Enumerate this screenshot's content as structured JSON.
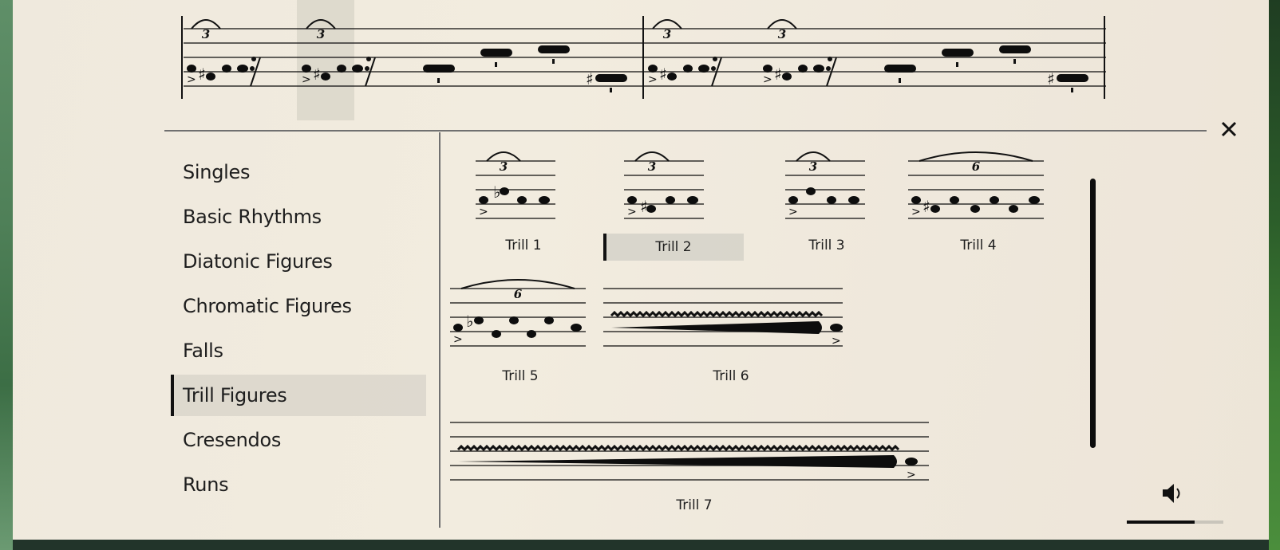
{
  "score_strip": {
    "measures": [
      {
        "beats": [
          "triplet-trill-sharp",
          "rest-figure",
          "triplet-trill-sharp",
          "rest-figure",
          "half-note-low",
          "half-note-mid",
          "half-note-high",
          "half-note-sharp"
        ]
      },
      {
        "beats": [
          "triplet-trill-sharp",
          "rest-figure",
          "triplet-trill-sharp",
          "rest-figure",
          "half-note-low",
          "half-note-mid",
          "half-note-high",
          "half-note-sharp"
        ]
      }
    ],
    "highlighted_beat_index": 2,
    "tuplet_label": "3"
  },
  "close_label": "close",
  "sidebar": {
    "items": [
      {
        "label": "Singles",
        "active": false
      },
      {
        "label": "Basic Rhythms",
        "active": false
      },
      {
        "label": "Diatonic Figures",
        "active": false
      },
      {
        "label": "Chromatic Figures",
        "active": false
      },
      {
        "label": "Falls",
        "active": false
      },
      {
        "label": "Trill Figures",
        "active": true
      },
      {
        "label": "Cresendos",
        "active": false
      },
      {
        "label": "Runs",
        "active": false
      }
    ]
  },
  "figures": [
    {
      "label": "Trill 1",
      "tuplet": "3",
      "accidental": "flat",
      "selected": false
    },
    {
      "label": "Trill 2",
      "tuplet": "3",
      "accidental": "sharp",
      "selected": true
    },
    {
      "label": "Trill 3",
      "tuplet": "3",
      "accidental": "none",
      "selected": false
    },
    {
      "label": "Trill 4",
      "tuplet": "6",
      "accidental": "sharp",
      "selected": false
    },
    {
      "label": "Trill 5",
      "tuplet": "6",
      "accidental": "flat",
      "selected": false
    },
    {
      "label": "Trill 6",
      "tuplet": "",
      "accidental": "none",
      "selected": false
    },
    {
      "label": "Trill 7",
      "tuplet": "",
      "accidental": "none",
      "selected": false
    }
  ],
  "volume": {
    "level": 0.7,
    "icon": "speaker-icon"
  },
  "colors": {
    "paper": "#efe9dd",
    "ink": "#0d0d0d",
    "highlight": "#d8d6cc",
    "footer": "#22342a"
  }
}
